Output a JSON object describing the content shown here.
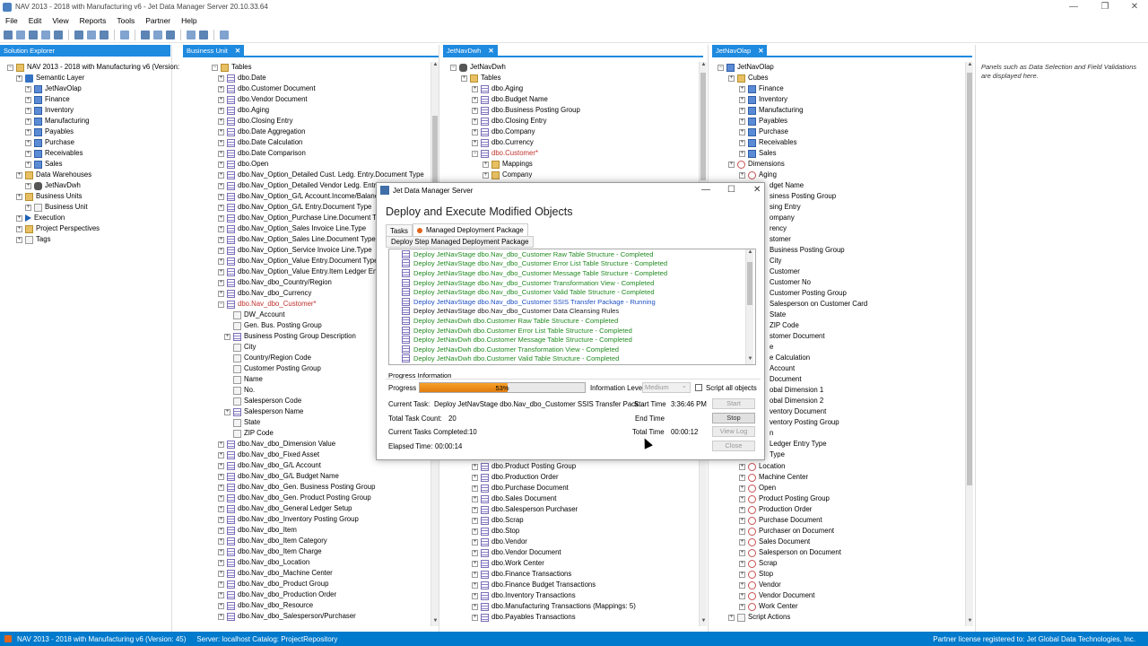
{
  "window": {
    "title": "NAV 2013 - 2018 with Manufacturing v6 - Jet Data Manager Server 20.10.33.64"
  },
  "menu": [
    "File",
    "Edit",
    "View",
    "Reports",
    "Tools",
    "Partner",
    "Help"
  ],
  "solution_explorer": {
    "tab": "Solution Explorer",
    "root": "NAV 2013 - 2018 with Manufacturing v6 (Version:",
    "items": [
      {
        "label": "Semantic Layer",
        "level": 1,
        "icon": "layer"
      },
      {
        "label": "JetNavOlap",
        "level": 2,
        "icon": "cube"
      },
      {
        "label": "Finance",
        "level": 2,
        "icon": "cube"
      },
      {
        "label": "Inventory",
        "level": 2,
        "icon": "cube"
      },
      {
        "label": "Manufacturing",
        "level": 2,
        "icon": "cube"
      },
      {
        "label": "Payables",
        "level": 2,
        "icon": "cube"
      },
      {
        "label": "Purchase",
        "level": 2,
        "icon": "cube"
      },
      {
        "label": "Receivables",
        "level": 2,
        "icon": "cube"
      },
      {
        "label": "Sales",
        "level": 2,
        "icon": "cube"
      },
      {
        "label": "Data Warehouses",
        "level": 1,
        "icon": "folder"
      },
      {
        "label": "JetNavDwh",
        "level": 2,
        "icon": "db"
      },
      {
        "label": "Business Units",
        "level": 1,
        "icon": "folder"
      },
      {
        "label": "Business Unit",
        "level": 2,
        "icon": "fld"
      },
      {
        "label": "Execution",
        "level": 1,
        "icon": "arrow"
      },
      {
        "label": "Project Perspectives",
        "level": 1,
        "icon": "folder"
      },
      {
        "label": "Tags",
        "level": 1,
        "icon": "fld"
      }
    ]
  },
  "business_unit": {
    "tab": "Business Unit",
    "root": "Tables",
    "items": [
      {
        "label": "dbo.Date",
        "level": 1
      },
      {
        "label": "dbo.Customer Document",
        "level": 1
      },
      {
        "label": "dbo.Vendor Document",
        "level": 1
      },
      {
        "label": "dbo.Aging",
        "level": 1
      },
      {
        "label": "dbo.Closing Entry",
        "level": 1
      },
      {
        "label": "dbo.Date Aggregation",
        "level": 1
      },
      {
        "label": "dbo.Date Calculation",
        "level": 1
      },
      {
        "label": "dbo.Date Comparison",
        "level": 1
      },
      {
        "label": "dbo.Open",
        "level": 1
      },
      {
        "label": "dbo.Nav_Option_Detailed Cust. Ledg. Entry.Document Type",
        "level": 1
      },
      {
        "label": "dbo.Nav_Option_Detailed Vendor Ledg. Entry.Do",
        "level": 1
      },
      {
        "label": "dbo.Nav_Option_G/L Account.Income/Balance",
        "level": 1
      },
      {
        "label": "dbo.Nav_Option_G/L Entry.Document Type",
        "level": 1
      },
      {
        "label": "dbo.Nav_Option_Purchase Line.Document Type",
        "level": 1
      },
      {
        "label": "dbo.Nav_Option_Sales Invoice Line.Type",
        "level": 1
      },
      {
        "label": "dbo.Nav_Option_Sales Line.Document Type",
        "level": 1
      },
      {
        "label": "dbo.Nav_Option_Service Invoice Line.Type",
        "level": 1
      },
      {
        "label": "dbo.Nav_Option_Value Entry.Document Type",
        "level": 1
      },
      {
        "label": "dbo.Nav_Option_Value Entry.Item Ledger Entry T",
        "level": 1
      },
      {
        "label": "dbo.Nav_dbo_Country/Region",
        "level": 1
      },
      {
        "label": "dbo.Nav_dbo_Currency",
        "level": 1
      },
      {
        "label": "dbo.Nav_dbo_Customer*",
        "level": 1,
        "modified": true,
        "expanded": true
      },
      {
        "label": "DW_Account",
        "level": 2,
        "field": true
      },
      {
        "label": "Gen. Bus. Posting Group",
        "level": 2,
        "field": true
      },
      {
        "label": "Business Posting Group Description",
        "level": 2,
        "field": true,
        "lookup": true
      },
      {
        "label": "City",
        "level": 2,
        "field": true
      },
      {
        "label": "Country/Region Code",
        "level": 2,
        "field": true
      },
      {
        "label": "Customer Posting Group",
        "level": 2,
        "field": true
      },
      {
        "label": "Name",
        "level": 2,
        "field": true
      },
      {
        "label": "No.",
        "level": 2,
        "field": true
      },
      {
        "label": "Salesperson Code",
        "level": 2,
        "field": true
      },
      {
        "label": "Salesperson Name",
        "level": 2,
        "field": true,
        "lookup": true
      },
      {
        "label": "State",
        "level": 2,
        "field": true
      },
      {
        "label": "ZIP Code",
        "level": 2,
        "field": true
      },
      {
        "label": "dbo.Nav_dbo_Dimension Value",
        "level": 1
      },
      {
        "label": "dbo.Nav_dbo_Fixed Asset",
        "level": 1
      },
      {
        "label": "dbo.Nav_dbo_G/L Account",
        "level": 1
      },
      {
        "label": "dbo.Nav_dbo_G/L Budget Name",
        "level": 1
      },
      {
        "label": "dbo.Nav_dbo_Gen. Business Posting Group",
        "level": 1
      },
      {
        "label": "dbo.Nav_dbo_Gen. Product Posting Group",
        "level": 1
      },
      {
        "label": "dbo.Nav_dbo_General Ledger Setup",
        "level": 1
      },
      {
        "label": "dbo.Nav_dbo_Inventory Posting Group",
        "level": 1
      },
      {
        "label": "dbo.Nav_dbo_Item",
        "level": 1
      },
      {
        "label": "dbo.Nav_dbo_Item Category",
        "level": 1
      },
      {
        "label": "dbo.Nav_dbo_Item Charge",
        "level": 1
      },
      {
        "label": "dbo.Nav_dbo_Location",
        "level": 1
      },
      {
        "label": "dbo.Nav_dbo_Machine Center",
        "level": 1
      },
      {
        "label": "dbo.Nav_dbo_Product Group",
        "level": 1
      },
      {
        "label": "dbo.Nav_dbo_Production Order",
        "level": 1
      },
      {
        "label": "dbo.Nav_dbo_Resource",
        "level": 1
      },
      {
        "label": "dbo.Nav_dbo_Salesperson/Purchaser",
        "level": 1
      }
    ]
  },
  "jetnavdwh": {
    "tab": "JetNavDwh",
    "top_items": [
      {
        "label": "JetNavDwh",
        "level": 0
      },
      {
        "label": "Tables",
        "level": 1
      },
      {
        "label": "dbo.Aging",
        "level": 2
      },
      {
        "label": "dbo.Budget Name",
        "level": 2
      },
      {
        "label": "dbo.Business Posting Group",
        "level": 2
      },
      {
        "label": "dbo.Closing Entry",
        "level": 2
      },
      {
        "label": "dbo.Company",
        "level": 2
      },
      {
        "label": "dbo.Currency",
        "level": 2
      },
      {
        "label": "dbo.Customer*",
        "level": 2,
        "modified": true,
        "expanded": true
      },
      {
        "label": "Mappings",
        "level": 3,
        "folder": true
      },
      {
        "label": "Company",
        "level": 3,
        "folder": true
      }
    ],
    "bottom_items": [
      {
        "label": "dbo.Product Posting Group",
        "level": 2
      },
      {
        "label": "dbo.Production Order",
        "level": 2
      },
      {
        "label": "dbo.Purchase Document",
        "level": 2
      },
      {
        "label": "dbo.Sales Document",
        "level": 2
      },
      {
        "label": "dbo.Salesperson Purchaser",
        "level": 2
      },
      {
        "label": "dbo.Scrap",
        "level": 2
      },
      {
        "label": "dbo.Stop",
        "level": 2
      },
      {
        "label": "dbo.Vendor",
        "level": 2
      },
      {
        "label": "dbo.Vendor Document",
        "level": 2
      },
      {
        "label": "dbo.Work Center",
        "level": 2
      },
      {
        "label": "dbo.Finance Transactions",
        "level": 2
      },
      {
        "label": "dbo.Finance Budget Transactions",
        "level": 2
      },
      {
        "label": "dbo.Inventory Transactions",
        "level": 2
      },
      {
        "label": "dbo.Manufacturing Transactions (Mappings: 5)",
        "level": 2
      },
      {
        "label": "dbo.Payables Transactions",
        "level": 2
      }
    ]
  },
  "jetnavolap": {
    "tab": "JetNavOlap",
    "top_items": [
      {
        "label": "JetNavOlap",
        "level": 0,
        "icon": "cube"
      },
      {
        "label": "Cubes",
        "level": 1,
        "icon": "folder"
      },
      {
        "label": "Finance",
        "level": 2,
        "icon": "cube"
      },
      {
        "label": "Inventory",
        "level": 2,
        "icon": "cube"
      },
      {
        "label": "Manufacturing",
        "level": 2,
        "icon": "cube"
      },
      {
        "label": "Payables",
        "level": 2,
        "icon": "cube"
      },
      {
        "label": "Purchase",
        "level": 2,
        "icon": "cube"
      },
      {
        "label": "Receivables",
        "level": 2,
        "icon": "cube"
      },
      {
        "label": "Sales",
        "level": 2,
        "icon": "cube"
      },
      {
        "label": "Dimensions",
        "level": 1,
        "icon": "dim"
      },
      {
        "label": "Aging",
        "level": 2,
        "icon": "dim"
      }
    ],
    "behind_dialog": [
      "dget Name",
      "siness Posting Group",
      "sing Entry",
      "ompany",
      "rency",
      "stomer",
      "Business Posting Group",
      "City",
      "Customer",
      "Customer No",
      "Customer Posting Group",
      "Salesperson on Customer Card",
      "State",
      "ZIP Code",
      "stomer Document",
      "e",
      "e Calculation",
      "Account",
      "Document",
      "obal Dimension 1",
      "obal Dimension 2",
      "ventory Document",
      "ventory Posting Group",
      "n",
      "Ledger Entry Type",
      "Type"
    ],
    "bottom_items": [
      {
        "label": "Location",
        "level": 2,
        "icon": "dim"
      },
      {
        "label": "Machine Center",
        "level": 2,
        "icon": "dim"
      },
      {
        "label": "Open",
        "level": 2,
        "icon": "dim"
      },
      {
        "label": "Product Posting Group",
        "level": 2,
        "icon": "dim"
      },
      {
        "label": "Production Order",
        "level": 2,
        "icon": "dim"
      },
      {
        "label": "Purchase Document",
        "level": 2,
        "icon": "dim"
      },
      {
        "label": "Purchaser on Document",
        "level": 2,
        "icon": "dim"
      },
      {
        "label": "Sales Document",
        "level": 2,
        "icon": "dim"
      },
      {
        "label": "Salesperson on Document",
        "level": 2,
        "icon": "dim"
      },
      {
        "label": "Scrap",
        "level": 2,
        "icon": "dim"
      },
      {
        "label": "Stop",
        "level": 2,
        "icon": "dim"
      },
      {
        "label": "Vendor",
        "level": 2,
        "icon": "dim"
      },
      {
        "label": "Vendor Document",
        "level": 2,
        "icon": "dim"
      },
      {
        "label": "Work Center",
        "level": 2,
        "icon": "dim"
      },
      {
        "label": "Script Actions",
        "level": 1,
        "icon": "fld"
      }
    ]
  },
  "right_note": "Panels such as Data Selection and Field Validations are displayed here.",
  "dialog": {
    "title": "Jet Data Manager Server",
    "heading": "Deploy and Execute Modified Objects",
    "tabs": [
      "Tasks",
      "Managed Deployment Package"
    ],
    "subtab": "Deploy Step Managed Deployment Package",
    "log": [
      {
        "text": "Deploy JetNavStage dbo.Nav_dbo_Customer Raw Table Structure - Completed",
        "status": "completed"
      },
      {
        "text": "Deploy JetNavStage dbo.Nav_dbo_Customer Error List Table Structure - Completed",
        "status": "completed"
      },
      {
        "text": "Deploy JetNavStage dbo.Nav_dbo_Customer Message Table Structure - Completed",
        "status": "completed"
      },
      {
        "text": "Deploy JetNavStage dbo.Nav_dbo_Customer Transformation View - Completed",
        "status": "completed"
      },
      {
        "text": "Deploy JetNavStage dbo.Nav_dbo_Customer Valid Table Structure - Completed",
        "status": "completed"
      },
      {
        "text": "Deploy JetNavStage dbo.Nav_dbo_Customer SSIS Transfer Package - Running",
        "status": "running"
      },
      {
        "text": "Deploy JetNavStage dbo.Nav_dbo_Customer Data Cleansing Rules",
        "status": "pending"
      },
      {
        "text": "Deploy JetNavDwh dbo.Customer Raw Table Structure - Completed",
        "status": "completed"
      },
      {
        "text": "Deploy JetNavDwh dbo.Customer Error List Table Structure - Completed",
        "status": "completed"
      },
      {
        "text": "Deploy JetNavDwh dbo.Customer Message Table Structure - Completed",
        "status": "completed"
      },
      {
        "text": "Deploy JetNavDwh dbo.Customer Transformation View - Completed",
        "status": "completed"
      },
      {
        "text": "Deploy JetNavDwh dbo.Customer Valid Table Structure - Completed",
        "status": "completed"
      }
    ],
    "progress_info_label": "Progress Information",
    "progress_label": "Progress",
    "progress_value": 53,
    "progress_text": "53%",
    "info_level_label": "Information Level",
    "info_level_value": "Medium",
    "script_all_label": "Script all objects",
    "current_task_label": "Current Task:",
    "current_task_value": "Deploy JetNavStage dbo.Nav_dbo_Customer SSIS Transfer Pack...",
    "total_task_label": "Total Task Count:",
    "total_task_value": "20",
    "completed_label": "Current Tasks Completed:",
    "completed_value": "10",
    "elapsed_label": "Elapsed Time:",
    "elapsed_value": "00:00:14",
    "start_time_label": "Start Time",
    "start_time_value": "3:36:46 PM",
    "end_time_label": "End Time",
    "total_time_label": "Total Time",
    "total_time_value": "00:00:12",
    "buttons": {
      "start": "Start",
      "stop": "Stop",
      "view_log": "View Log",
      "close": "Close"
    }
  },
  "status": {
    "project": "NAV 2013 - 2018 with Manufacturing v6 (Version: 45)",
    "server": "Server: localhost Catalog: ProjectRepository",
    "license": "Partner license registered to: Jet Global Data Technologies, Inc."
  }
}
